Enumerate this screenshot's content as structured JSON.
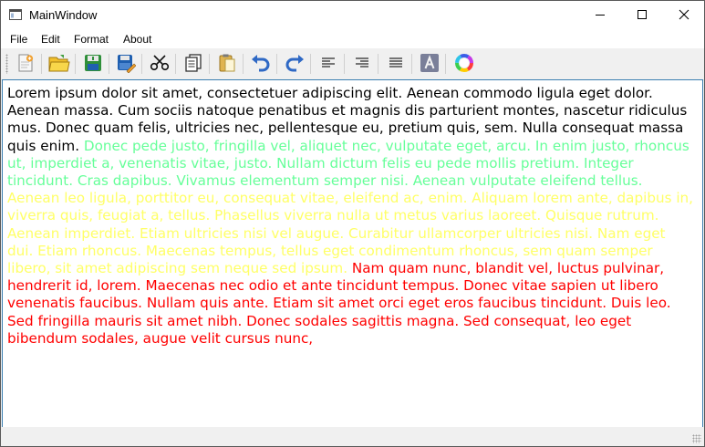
{
  "window": {
    "title": "MainWindow"
  },
  "menu": [
    "File",
    "Edit",
    "Format",
    "About"
  ],
  "toolbar": {
    "buttons": [
      "new-document",
      "open-folder",
      "save",
      "save-as",
      "cut",
      "copy",
      "paste",
      "undo",
      "redo",
      "align-left",
      "align-right",
      "justify",
      "text-color",
      "color-wheel"
    ]
  },
  "editor": {
    "segments": [
      {
        "text": "Lorem ipsum dolor sit amet, consectetuer adipiscing elit. Aenean commodo ligula eget dolor. Aenean massa. Cum sociis natoque penatibus et magnis dis parturient montes, nascetur ridiculus mus. Donec quam felis, ultricies nec, pellentesque eu, pretium quis, sem. Nulla consequat massa quis enim. ",
        "color": "#000000"
      },
      {
        "text": "Donec pede justo, fringilla vel, aliquet nec, vulputate eget, arcu. In enim justo, rhoncus ut, imperdiet a, venenatis vitae, justo. Nullam dictum felis eu pede mollis pretium. Integer tincidunt. Cras dapibus. Vivamus elementum semper nisi. Aenean vulputate eleifend tellus. ",
        "color": "#66ff99"
      },
      {
        "text": "Aenean leo ligula, porttitor eu, consequat vitae, eleifend ac, enim. Aliquam lorem ante, dapibus in, viverra quis, feugiat a, tellus. Phasellus viverra nulla ut metus varius laoreet. Quisque rutrum. Aenean imperdiet. Etiam ultricies nisi vel augue. Curabitur ullamcorper ultricies nisi. Nam eget dui. Etiam rhoncus. Maecenas tempus, tellus eget condimentum rhoncus, sem quam semper libero, sit amet adipiscing sem neque sed ipsum. ",
        "color": "#ffff66"
      },
      {
        "text": "Nam quam nunc, blandit vel, luctus pulvinar, hendrerit id, lorem. Maecenas nec odio et ante tincidunt tempus. Donec vitae sapien ut libero venenatis faucibus. Nullam quis ante. Etiam sit amet orci eget eros faucibus tincidunt. Duis leo. Sed fringilla mauris sit amet nibh. Donec sodales sagittis magna. Sed consequat, leo eget bibendum sodales, augue velit cursus nunc,",
        "color": "#ff0000"
      }
    ]
  }
}
